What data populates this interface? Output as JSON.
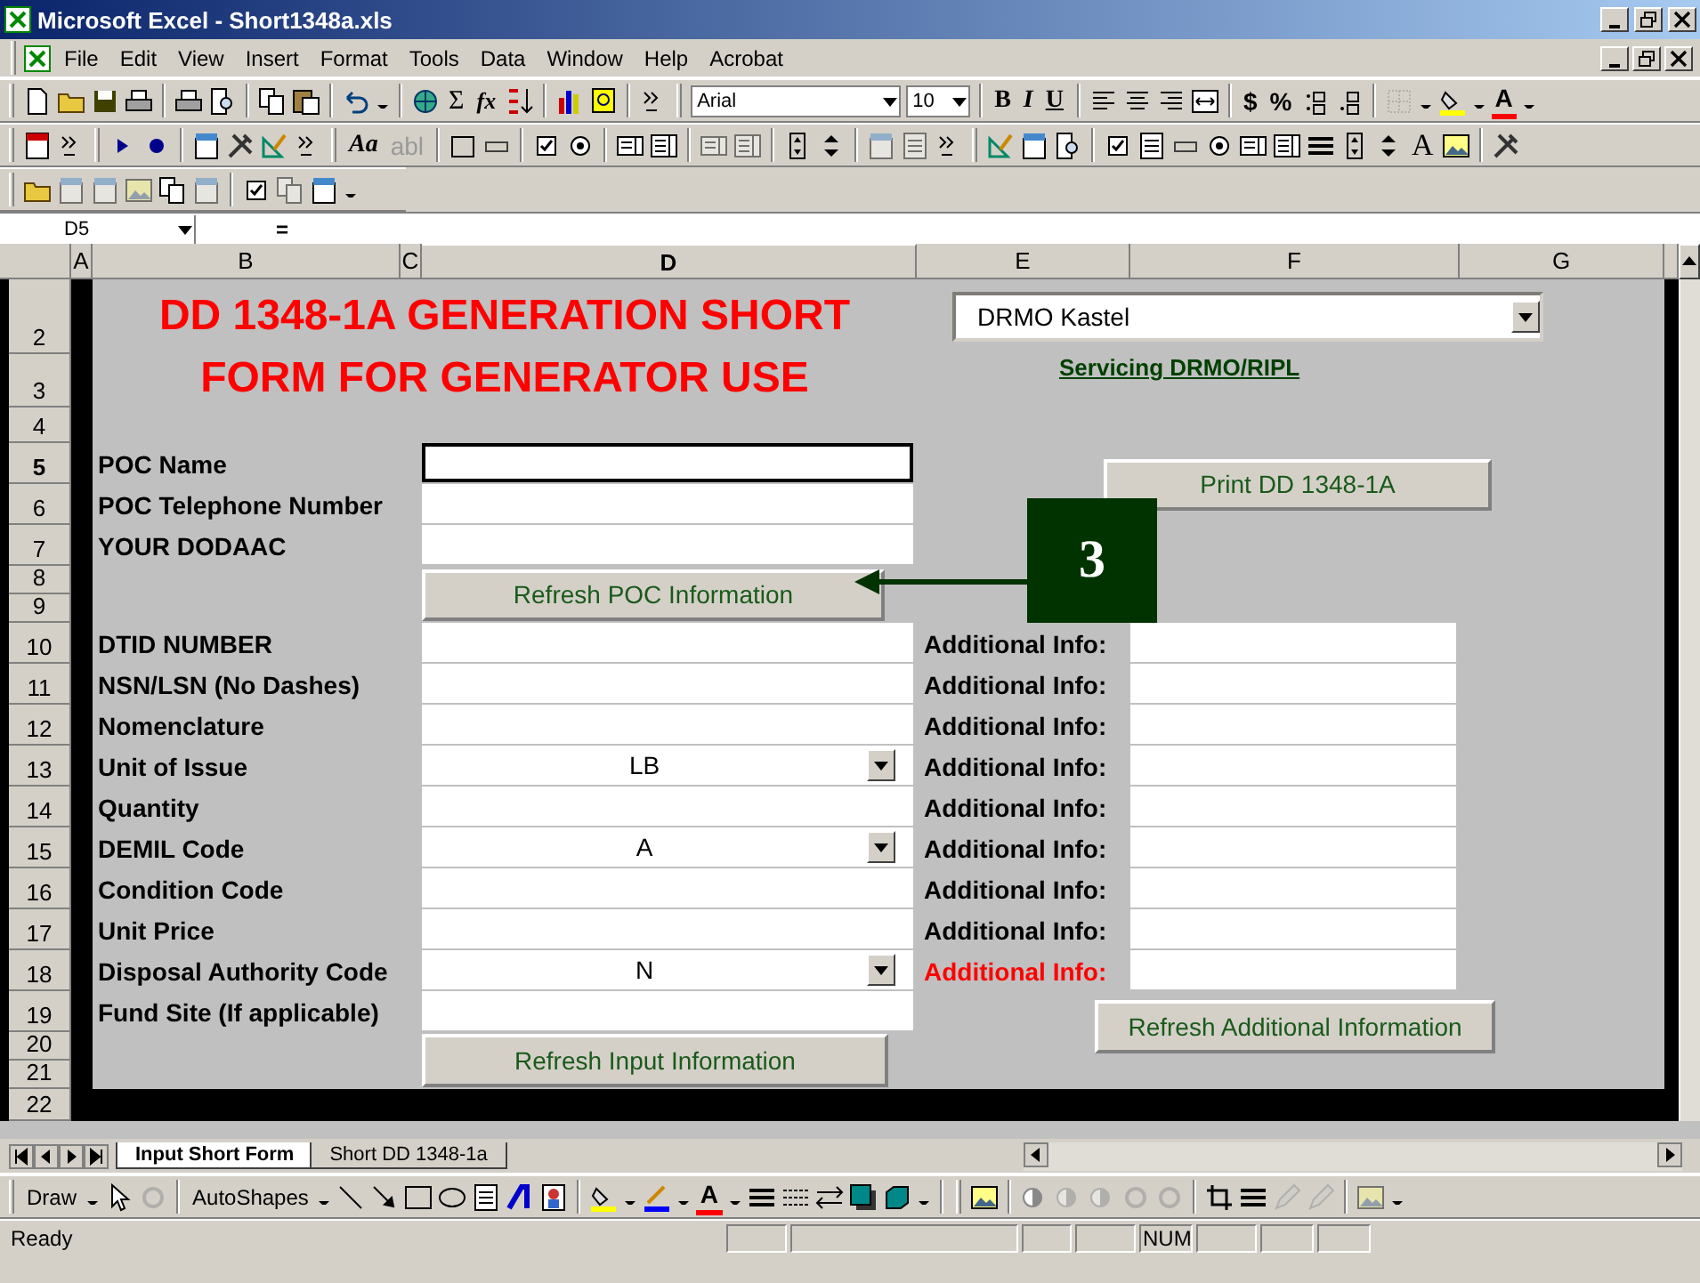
{
  "window": {
    "title": "Microsoft Excel - Short1348a.xls"
  },
  "menu": [
    {
      "label": "File"
    },
    {
      "label": "Edit"
    },
    {
      "label": "View"
    },
    {
      "label": "Insert"
    },
    {
      "label": "Format"
    },
    {
      "label": "Tools"
    },
    {
      "label": "Data"
    },
    {
      "label": "Window"
    },
    {
      "label": "Help"
    },
    {
      "label": "Acrobat"
    }
  ],
  "standard_toolbar": {
    "autosum": "Σ",
    "function": "fx"
  },
  "formatting_toolbar": {
    "font": "Arial",
    "size": "10",
    "bold": "B",
    "italic": "I",
    "underline": "U",
    "currency": "$",
    "percent": "%",
    "font_color": "A"
  },
  "forms_toolbar": {
    "label_tool": "Aa",
    "edit_box_tool": "abl"
  },
  "controls_toolbar": {
    "label_tool": "A"
  },
  "formula_bar": {
    "name_box": "D5",
    "equals": "="
  },
  "columns": [
    {
      "label": "A",
      "selected": false
    },
    {
      "label": "B",
      "selected": false
    },
    {
      "label": "C",
      "selected": false
    },
    {
      "label": "D",
      "selected": true
    },
    {
      "label": "E",
      "selected": false
    },
    {
      "label": "F",
      "selected": false
    },
    {
      "label": "G",
      "selected": false
    }
  ],
  "rows": [
    {
      "label": "2",
      "selected": false
    },
    {
      "label": "3",
      "selected": false
    },
    {
      "label": "4",
      "selected": false
    },
    {
      "label": "5",
      "selected": true
    },
    {
      "label": "6",
      "selected": false
    },
    {
      "label": "7",
      "selected": false
    },
    {
      "label": "8",
      "selected": false
    },
    {
      "label": "9",
      "selected": false
    },
    {
      "label": "10",
      "selected": false
    },
    {
      "label": "11",
      "selected": false
    },
    {
      "label": "12",
      "selected": false
    },
    {
      "label": "13",
      "selected": false
    },
    {
      "label": "14",
      "selected": false
    },
    {
      "label": "15",
      "selected": false
    },
    {
      "label": "16",
      "selected": false
    },
    {
      "label": "17",
      "selected": false
    },
    {
      "label": "18",
      "selected": false
    },
    {
      "label": "19",
      "selected": false
    },
    {
      "label": "20",
      "selected": false
    },
    {
      "label": "21",
      "selected": false
    },
    {
      "label": "22",
      "selected": false
    }
  ],
  "sheet": {
    "title_lines": [
      "DD 1348-1A GENERATION SHORT",
      "FORM FOR GENERATOR USE"
    ],
    "site_dropdown": {
      "value": "DRMO Kastel"
    },
    "site_link": "Servicing DRMO/RIPL",
    "print_button": "Print DD 1348-1A",
    "poc_fields": [
      {
        "label": "POC Name",
        "focused": true
      },
      {
        "label": "POC Telephone Number",
        "focused": false
      },
      {
        "label": "YOUR DODAAC",
        "focused": false
      }
    ],
    "refresh_poc_button": "Refresh POC Information",
    "callout": {
      "label": "3"
    },
    "item_fields": [
      {
        "label": "DTID NUMBER",
        "kind": "text"
      },
      {
        "label": "NSN/LSN (No Dashes)",
        "kind": "text"
      },
      {
        "label": "Nomenclature",
        "kind": "text"
      },
      {
        "label": "Unit of Issue",
        "kind": "dropdown",
        "value": "LB"
      },
      {
        "label": "Quantity",
        "kind": "text"
      },
      {
        "label": "DEMIL Code",
        "kind": "dropdown",
        "value": "A"
      },
      {
        "label": "Condition Code",
        "kind": "text"
      },
      {
        "label": "Unit Price",
        "kind": "text"
      },
      {
        "label": "Disposal Authority Code",
        "kind": "dropdown",
        "value": "N"
      },
      {
        "label": "Fund Site (If applicable)",
        "kind": "text"
      }
    ],
    "additional_info": [
      {
        "label": "Additional Info:",
        "highlighted": false
      },
      {
        "label": "Additional Info:",
        "highlighted": false
      },
      {
        "label": "Additional Info:",
        "highlighted": false
      },
      {
        "label": "Additional Info:",
        "highlighted": false
      },
      {
        "label": "Additional Info:",
        "highlighted": false
      },
      {
        "label": "Additional Info:",
        "highlighted": false
      },
      {
        "label": "Additional Info:",
        "highlighted": false
      },
      {
        "label": "Additional Info:",
        "highlighted": false
      },
      {
        "label": "Additional Info:",
        "highlighted": true
      }
    ],
    "refresh_input_button": "Refresh Input Information",
    "refresh_additional_button": "Refresh Additional Information"
  },
  "sheet_tabs": [
    {
      "label": "Input Short Form",
      "selected": true
    },
    {
      "label": "Short DD 1348-1a",
      "selected": false
    }
  ],
  "drawing_toolbar": {
    "draw": "Draw",
    "autoshapes": "AutoShapes",
    "font_color": "A"
  },
  "status_bar": {
    "text": "Ready",
    "num": "NUM"
  }
}
